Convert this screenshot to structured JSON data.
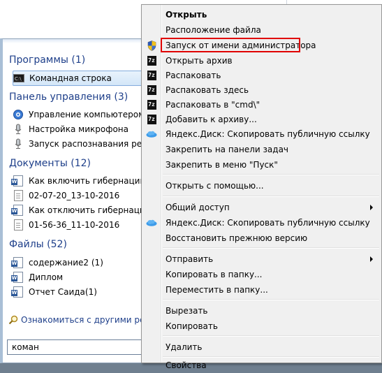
{
  "start_menu": {
    "groups": {
      "programs": "Программы (1)",
      "control_panel": "Панель управления (3)",
      "documents": "Документы (12)",
      "files": "Файлы (52)"
    },
    "programs": [
      {
        "label": "Командная строка",
        "icon": "cmd-icon",
        "selected": true
      }
    ],
    "control_panel": [
      {
        "label": "Управление компьютером б",
        "icon": "computer-management-icon"
      },
      {
        "label": "Настройка микрофона",
        "icon": "microphone-icon"
      },
      {
        "label": "Запуск распознавания речи",
        "icon": "microphone-icon"
      }
    ],
    "documents": [
      {
        "label": "Как включить гибернацию в",
        "icon": "word-doc-icon"
      },
      {
        "label": "02-07-20_13-10-2016",
        "icon": "document-icon"
      },
      {
        "label": "Как отключить гибернацию",
        "icon": "word-doc-icon"
      },
      {
        "label": "01-56-36_11-10-2016",
        "icon": "document-icon"
      }
    ],
    "files": [
      {
        "label": "содержание2 (1)",
        "icon": "word-doc-icon"
      },
      {
        "label": "Диплом",
        "icon": "word-doc-icon"
      },
      {
        "label": "Отчет Саида(1)",
        "icon": "word-doc-icon"
      }
    ],
    "see_more": "Ознакомиться с другими резул",
    "search_value": "коман"
  },
  "context_menu": {
    "items": [
      {
        "label": "Открыть",
        "bold": true
      },
      {
        "label": "Расположение файла"
      },
      {
        "label": "Запуск от имени администратора",
        "icon": "uac-shield-icon",
        "highlighted": true
      },
      {
        "label": "Открыть архив",
        "icon": "7zip-icon"
      },
      {
        "label": "Распаковать",
        "icon": "7zip-icon"
      },
      {
        "label": "Распаковать здесь",
        "icon": "7zip-icon"
      },
      {
        "label": "Распаковать в \"cmd\\\"",
        "icon": "7zip-icon"
      },
      {
        "label": "Добавить к архиву...",
        "icon": "7zip-icon"
      },
      {
        "label": "Яндекс.Диск: Скопировать публичную ссылку",
        "icon": "yandex-disk-icon"
      },
      {
        "label": "Закрепить на панели задач"
      },
      {
        "label": "Закрепить в меню \"Пуск\""
      },
      {
        "label": "Открыть с помощью..."
      },
      {
        "label": "Общий доступ",
        "submenu": true
      },
      {
        "label": "Яндекс.Диск: Скопировать публичную ссылку",
        "icon": "yandex-disk-icon"
      },
      {
        "label": "Восстановить прежнюю версию"
      },
      {
        "label": "Отправить",
        "submenu": true
      },
      {
        "label": "Копировать в папку..."
      },
      {
        "label": "Переместить в папку..."
      },
      {
        "label": "Вырезать"
      },
      {
        "label": "Копировать"
      },
      {
        "label": "Удалить"
      },
      {
        "label": "Свойства"
      }
    ]
  },
  "colors": {
    "group_header": "#1e3f8a",
    "highlight_border": "#e00000",
    "menu_bg": "#f0f0f0"
  }
}
